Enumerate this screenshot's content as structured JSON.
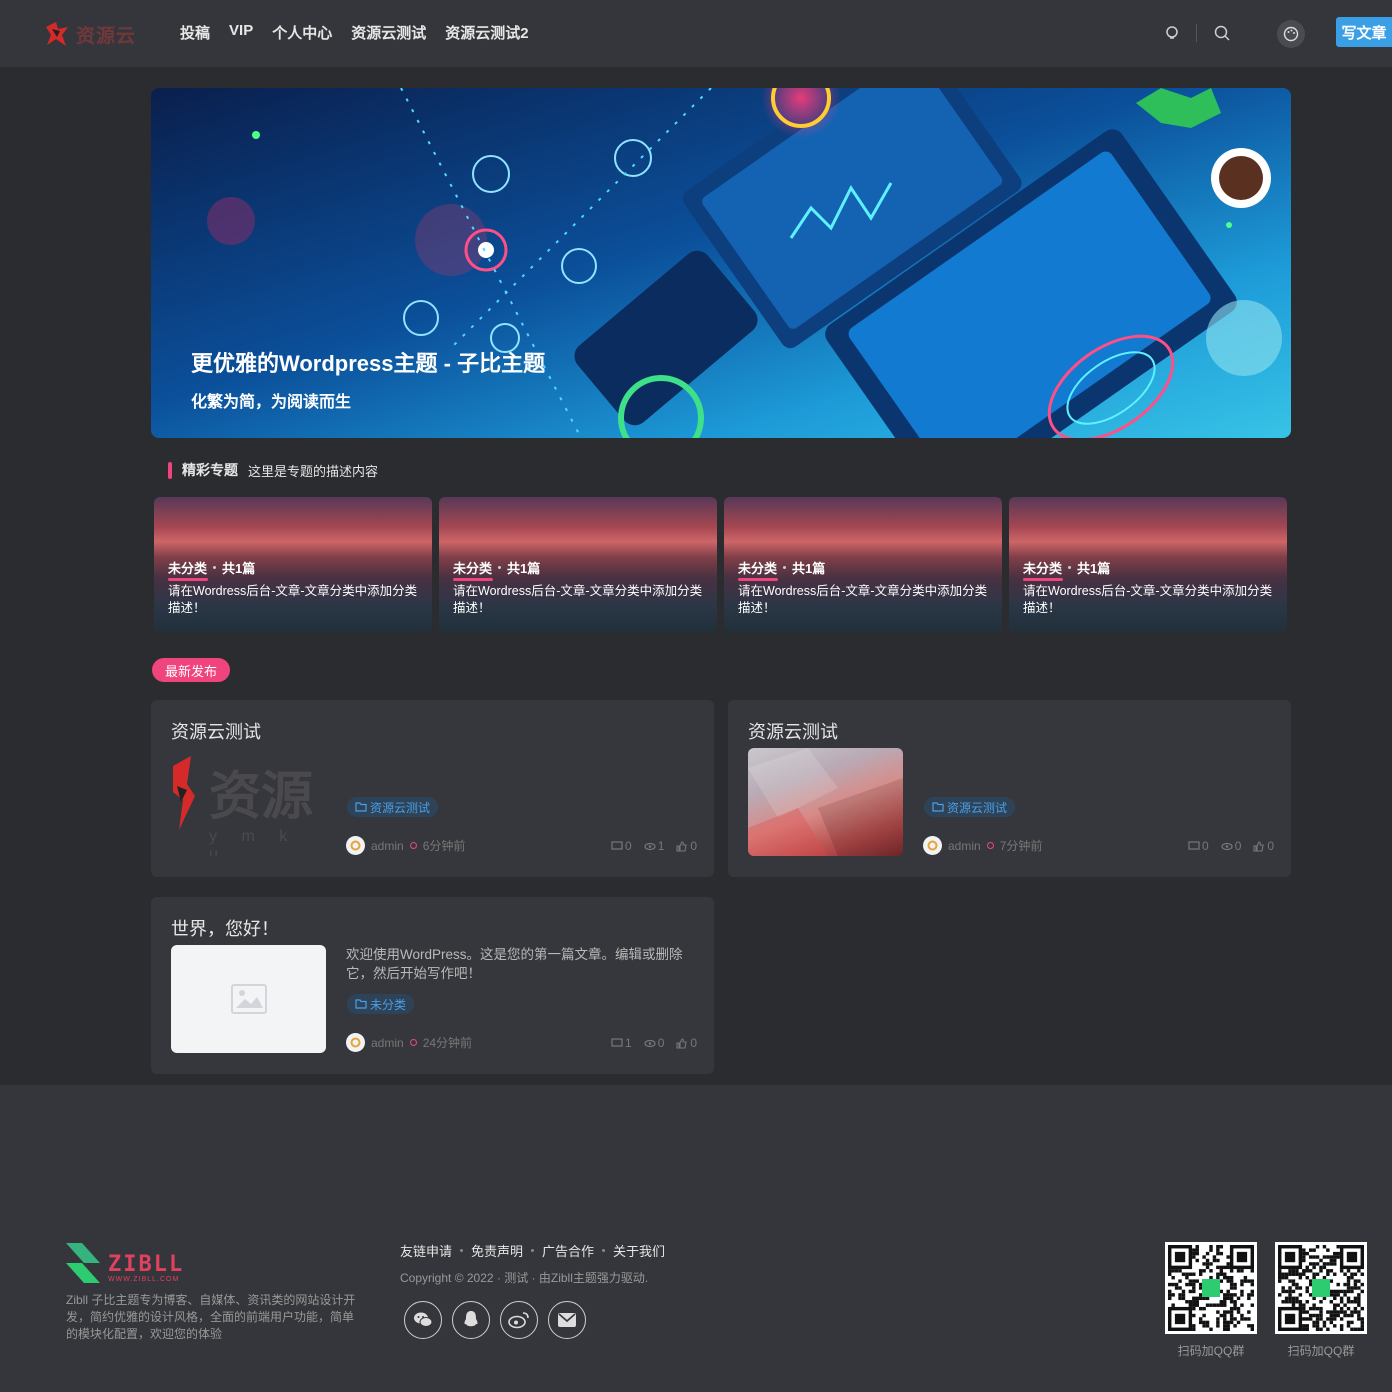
{
  "header": {
    "logo_text": "资源云",
    "nav": [
      "投稿",
      "VIP",
      "个人中心",
      "资源云测试",
      "资源云测试2"
    ],
    "write_label": "写文章"
  },
  "banner": {
    "title": "更优雅的Wordpress主题 - 子比主题",
    "subtitle": "化繁为简，为阅读而生"
  },
  "topics_section": {
    "title": "精彩专题",
    "description": "这里是专题的描述内容",
    "items": [
      {
        "category": "未分类",
        "count": "共1篇",
        "desc": "请在Wordress后台-文章-文章分类中添加分类描述！"
      },
      {
        "category": "未分类",
        "count": "共1篇",
        "desc": "请在Wordress后台-文章-文章分类中添加分类描述！"
      },
      {
        "category": "未分类",
        "count": "共1篇",
        "desc": "请在Wordress后台-文章-文章分类中添加分类描述！"
      },
      {
        "category": "未分类",
        "count": "共1篇",
        "desc": "请在Wordress后台-文章-文章分类中添加分类描述！"
      }
    ]
  },
  "latest_badge": "最新发布",
  "posts": [
    {
      "title": "资源云测试",
      "thumb_text": "资源",
      "thumb_sub": "y m k u .",
      "tag": "资源云测试",
      "author": "admin",
      "time": "6分钟前",
      "comments": "0",
      "views": "1",
      "likes": "0"
    },
    {
      "title": "资源云测试",
      "tag": "资源云测试",
      "author": "admin",
      "time": "7分钟前",
      "comments": "0",
      "views": "0",
      "likes": "0"
    },
    {
      "title": "世界，您好！",
      "excerpt": "欢迎使用WordPress。这是您的第一篇文章。编辑或删除它，然后开始写作吧！",
      "tag": "未分类",
      "author": "admin",
      "time": "24分钟前",
      "comments": "1",
      "views": "0",
      "likes": "0"
    }
  ],
  "footer": {
    "logo_text": "ZIBLL",
    "logo_sub": "WWW.ZIBLL.COM",
    "description": "Zibll 子比主题专为博客、自媒体、资讯类的网站设计开发，简约优雅的设计风格，全面的前端用户功能，简单的模块化配置，欢迎您的体验",
    "links": [
      "友链申请",
      "免责声明",
      "广告合作",
      "关于我们"
    ],
    "copyright": "Copyright © 2022 · 测试 · 由Zibll主题强力驱动.",
    "socials": [
      "wechat-icon",
      "qq-icon",
      "weibo-icon",
      "mail-icon"
    ],
    "qr_labels": [
      "扫码加QQ群",
      "扫码加QQ群"
    ]
  },
  "colors": {
    "accent": "#f0447d",
    "primary": "#3b9fe6",
    "background": "#2b2c30",
    "card": "#36373c"
  }
}
